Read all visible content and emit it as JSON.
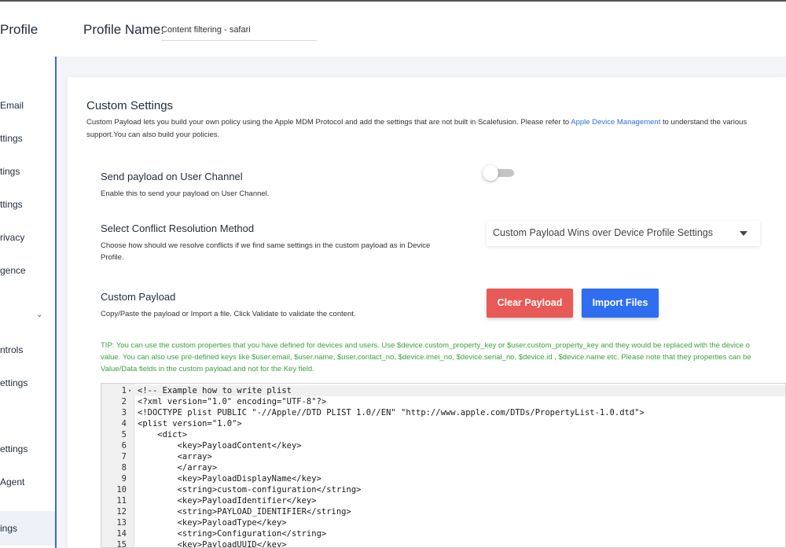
{
  "header": {
    "brand": "Profile",
    "profile_name_label": "Profile Name:",
    "profile_name_value": "Content filtering - safari"
  },
  "sidebar": {
    "items": [
      "Email",
      "ttings",
      "tings",
      "ttings",
      "rivacy",
      "gence",
      "ntrols",
      "ettings",
      "ettings",
      "Agent",
      "ings"
    ],
    "chevron": "⌄"
  },
  "custom_settings": {
    "title": "Custom Settings",
    "desc_part1": "Custom Payload lets you build your own policy using the Apple MDM Protocol and add the settings that are not built in Scalefusion. Please refer to ",
    "desc_link": "Apple Device Management",
    "desc_part2": " to understand the various",
    "desc_line2": "support.You can also build your policies."
  },
  "user_channel": {
    "title": "Send payload on User Channel",
    "desc": "Enable this to send your payload on User Channel.",
    "enabled": false
  },
  "conflict": {
    "title": "Select Conflict Resolution Method",
    "desc_line1": "Choose how should we resolve conflicts if we find same settings in the custom payload as in Device",
    "desc_line2": "Profile.",
    "selected": "Custom Payload Wins over Device Profile Settings"
  },
  "payload": {
    "title": "Custom Payload",
    "desc": "Copy/Paste the payload or Import a file. Click Validate to validate the content.",
    "clear_label": "Clear Payload",
    "import_label": "Import Files"
  },
  "tip": {
    "line1": "TIP: You can use the custom properties that you have defined for devices and users. Use $device.custom_property_key or $user.custom_property_key and they would be replaced with the device o",
    "line2": "value. You can also use pre-defined keys like $user.email, $user.name, $user.contact_no, $device.imei_no, $device.serial_no, $device.id , $device.name etc. Please note that they properties can be",
    "line3": "Value/Data fields in the custom payload and not for the Key field."
  },
  "editor": {
    "lines": [
      {
        "n": "1",
        "code": "<!-- Example how to write plist"
      },
      {
        "n": "2",
        "code": "<?xml version=\"1.0\" encoding=\"UTF-8\"?>"
      },
      {
        "n": "3",
        "code": "<!DOCTYPE plist PUBLIC \"-//Apple//DTD PLIST 1.0//EN\" \"http://www.apple.com/DTDs/PropertyList-1.0.dtd\">"
      },
      {
        "n": "4",
        "code": "<plist version=\"1.0\">"
      },
      {
        "n": "5",
        "code": "    <dict>"
      },
      {
        "n": "6",
        "code": "        <key>PayloadContent</key>"
      },
      {
        "n": "7",
        "code": "        <array>"
      },
      {
        "n": "8",
        "code": "        </array>"
      },
      {
        "n": "9",
        "code": "        <key>PayloadDisplayName</key>"
      },
      {
        "n": "10",
        "code": "        <string>custom-configuration</string>"
      },
      {
        "n": "11",
        "code": "        <key>PayloadIdentifier</key>"
      },
      {
        "n": "12",
        "code": "        <string>PAYLOAD_IDENTIFIER</string>"
      },
      {
        "n": "13",
        "code": "        <key>PayloadType</key>"
      },
      {
        "n": "14",
        "code": "        <string>Configuration</string>"
      },
      {
        "n": "15",
        "code": "        <key>PayloadUUID</key>"
      }
    ],
    "fold_marker": "▾"
  }
}
